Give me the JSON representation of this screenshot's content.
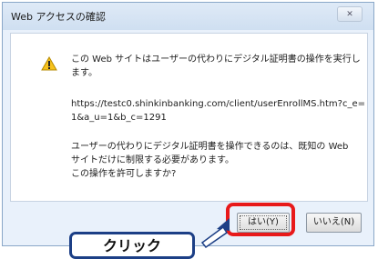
{
  "dialog": {
    "title": "Web アクセスの確認",
    "close_symbol": "✕",
    "message_top": "この Web サイトはユーザーの代わりにデジタル証明書の操作を実行します。",
    "url": "https://testc0.shinkinbanking.com/client/userEnrollMS.htm?c_e=1&a_u=1&b_c=1291",
    "message_bottom": "ユーザーの代わりにデジタル証明書を操作できるのは、既知の Web\nサイトだけに制限する必要があります。\nこの操作を許可しますか?",
    "yes_label": "はい(Y)",
    "no_label": "いいえ(N)",
    "icon": "warning-icon"
  },
  "annotation": {
    "callout_text": "クリック",
    "highlight_color": "#e8191a",
    "callout_border_color": "#1c3f86"
  }
}
